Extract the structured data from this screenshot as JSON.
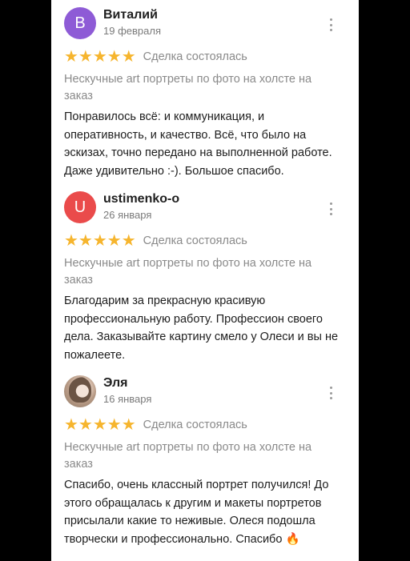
{
  "reviews": [
    {
      "avatar_letter": "В",
      "avatar_color": "#8e5bd6",
      "name": "Виталий",
      "date": "19 февраля",
      "stars": "★★★★★",
      "status": "Сделка состоялась",
      "product": "Нескучные art портреты по фото на холсте на заказ",
      "text": "Понравилось всё: и коммуникация, и оперативность, и качество. Всё, что было на эскизах, точно передано на выполненной работе. Даже удивительно :-). Большое спасибо."
    },
    {
      "avatar_letter": "U",
      "avatar_color": "#ea4b4b",
      "name": "ustimenko-o",
      "date": "26 января",
      "stars": "★★★★★",
      "status": "Сделка состоялась",
      "product": "Нескучные art портреты по фото на холсте на заказ",
      "text": "Благодарим за прекрасную красивую профессиональную работу. Профессион своего дела. Заказывайте картину смело у Олеси и вы не пожалеете."
    },
    {
      "avatar_letter": "",
      "avatar_color": "#b79a85",
      "name": "Эля",
      "date": "16 января",
      "stars": "★★★★★",
      "status": "Сделка состоялась",
      "product": "Нескучные art портреты по фото на холсте на заказ",
      "text": "Спасибо, очень классный портрет получился! До этого обращалась к другим и макеты портретов присылали какие то неживые. Олеся подошла творчески и профессионально. Спасибо 🔥"
    }
  ]
}
